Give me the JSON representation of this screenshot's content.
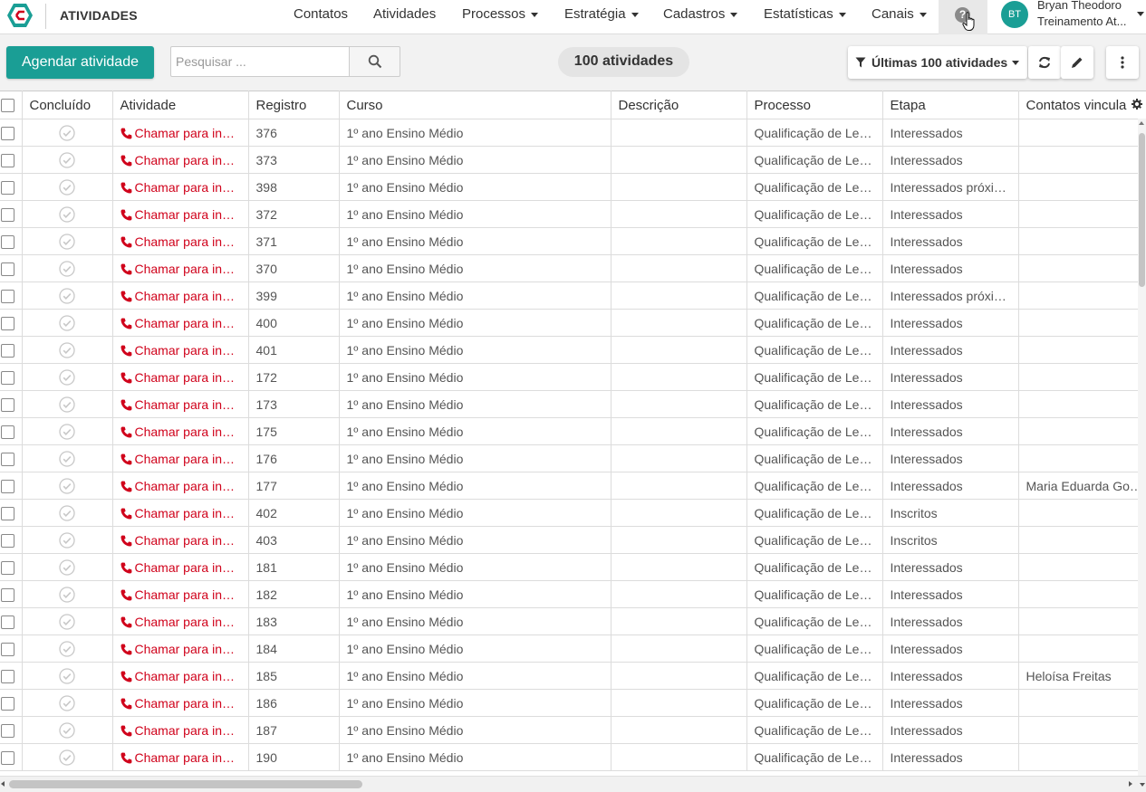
{
  "app": {
    "page_title": "ATIVIDADES",
    "brand_color": "#1a9e95",
    "accent_red": "#d0021b"
  },
  "nav": {
    "items": [
      {
        "label": "Contatos",
        "dropdown": false
      },
      {
        "label": "Atividades",
        "dropdown": false
      },
      {
        "label": "Processos",
        "dropdown": true
      },
      {
        "label": "Estratégia",
        "dropdown": true
      },
      {
        "label": "Cadastros",
        "dropdown": true
      },
      {
        "label": "Estatísticas",
        "dropdown": true
      },
      {
        "label": "Canais",
        "dropdown": true
      }
    ],
    "help_icon": "question-circle-icon"
  },
  "user": {
    "initials": "BT",
    "name": "Bryan Theodoro",
    "org": "Treinamento At..."
  },
  "toolbar": {
    "schedule_label": "Agendar atividade",
    "search_placeholder": "Pesquisar ...",
    "search_value": "",
    "count_label": "100 atividades",
    "filter_label": "Últimas 100 atividades",
    "refresh_icon": "refresh-icon",
    "edit_icon": "pencil-icon",
    "more_icon": "more-vertical-icon"
  },
  "table": {
    "columns": [
      "Concluído",
      "Atividade",
      "Registro",
      "Curso",
      "Descrição",
      "Processo",
      "Etapa",
      "Contatos vinculados"
    ],
    "rows": [
      {
        "atividade": "Chamar para inscrição",
        "registro": "376",
        "curso": "1º ano Ensino Médio",
        "descricao": "",
        "processo": "Qualificação de Leads",
        "etapa": "Interessados",
        "contatos": ""
      },
      {
        "atividade": "Chamar para inscrição",
        "registro": "373",
        "curso": "1º ano Ensino Médio",
        "descricao": "",
        "processo": "Qualificação de Leads",
        "etapa": "Interessados",
        "contatos": ""
      },
      {
        "atividade": "Chamar para inscrição",
        "registro": "398",
        "curso": "1º ano Ensino Médio",
        "descricao": "",
        "processo": "Qualificação de Leads",
        "etapa": "Interessados próximo ano",
        "contatos": ""
      },
      {
        "atividade": "Chamar para inscrição",
        "registro": "372",
        "curso": "1º ano Ensino Médio",
        "descricao": "",
        "processo": "Qualificação de Leads",
        "etapa": "Interessados",
        "contatos": ""
      },
      {
        "atividade": "Chamar para inscrição",
        "registro": "371",
        "curso": "1º ano Ensino Médio",
        "descricao": "",
        "processo": "Qualificação de Leads",
        "etapa": "Interessados",
        "contatos": ""
      },
      {
        "atividade": "Chamar para inscrição",
        "registro": "370",
        "curso": "1º ano Ensino Médio",
        "descricao": "",
        "processo": "Qualificação de Leads",
        "etapa": "Interessados",
        "contatos": ""
      },
      {
        "atividade": "Chamar para inscrição",
        "registro": "399",
        "curso": "1º ano Ensino Médio",
        "descricao": "",
        "processo": "Qualificação de Leads",
        "etapa": "Interessados próximo ano",
        "contatos": ""
      },
      {
        "atividade": "Chamar para inscrição",
        "registro": "400",
        "curso": "1º ano Ensino Médio",
        "descricao": "",
        "processo": "Qualificação de Leads",
        "etapa": "Interessados",
        "contatos": ""
      },
      {
        "atividade": "Chamar para inscrição",
        "registro": "401",
        "curso": "1º ano Ensino Médio",
        "descricao": "",
        "processo": "Qualificação de Leads",
        "etapa": "Interessados",
        "contatos": ""
      },
      {
        "atividade": "Chamar para inscrição",
        "registro": "172",
        "curso": "1º ano Ensino Médio",
        "descricao": "",
        "processo": "Qualificação de Leads",
        "etapa": "Interessados",
        "contatos": ""
      },
      {
        "atividade": "Chamar para inscrição",
        "registro": "173",
        "curso": "1º ano Ensino Médio",
        "descricao": "",
        "processo": "Qualificação de Leads",
        "etapa": "Interessados",
        "contatos": ""
      },
      {
        "atividade": "Chamar para inscrição",
        "registro": "175",
        "curso": "1º ano Ensino Médio",
        "descricao": "",
        "processo": "Qualificação de Leads",
        "etapa": "Interessados",
        "contatos": ""
      },
      {
        "atividade": "Chamar para inscrição",
        "registro": "176",
        "curso": "1º ano Ensino Médio",
        "descricao": "",
        "processo": "Qualificação de Leads",
        "etapa": "Interessados",
        "contatos": ""
      },
      {
        "atividade": "Chamar para inscrição",
        "registro": "177",
        "curso": "1º ano Ensino Médio",
        "descricao": "",
        "processo": "Qualificação de Leads",
        "etapa": "Interessados",
        "contatos": "Maria Eduarda Gonçalves"
      },
      {
        "atividade": "Chamar para inscrição",
        "registro": "402",
        "curso": "1º ano Ensino Médio",
        "descricao": "",
        "processo": "Qualificação de Leads",
        "etapa": "Inscritos",
        "contatos": ""
      },
      {
        "atividade": "Chamar para inscrição",
        "registro": "403",
        "curso": "1º ano Ensino Médio",
        "descricao": "",
        "processo": "Qualificação de Leads",
        "etapa": "Inscritos",
        "contatos": ""
      },
      {
        "atividade": "Chamar para inscrição",
        "registro": "181",
        "curso": "1º ano Ensino Médio",
        "descricao": "",
        "processo": "Qualificação de Leads",
        "etapa": "Interessados",
        "contatos": ""
      },
      {
        "atividade": "Chamar para inscrição",
        "registro": "182",
        "curso": "1º ano Ensino Médio",
        "descricao": "",
        "processo": "Qualificação de Leads",
        "etapa": "Interessados",
        "contatos": ""
      },
      {
        "atividade": "Chamar para inscrição",
        "registro": "183",
        "curso": "1º ano Ensino Médio",
        "descricao": "",
        "processo": "Qualificação de Leads",
        "etapa": "Interessados",
        "contatos": ""
      },
      {
        "atividade": "Chamar para inscrição",
        "registro": "184",
        "curso": "1º ano Ensino Médio",
        "descricao": "",
        "processo": "Qualificação de Leads",
        "etapa": "Interessados",
        "contatos": ""
      },
      {
        "atividade": "Chamar para inscrição",
        "registro": "185",
        "curso": "1º ano Ensino Médio",
        "descricao": "",
        "processo": "Qualificação de Leads",
        "etapa": "Interessados",
        "contatos": "Heloísa Freitas"
      },
      {
        "atividade": "Chamar para inscrição",
        "registro": "186",
        "curso": "1º ano Ensino Médio",
        "descricao": "",
        "processo": "Qualificação de Leads",
        "etapa": "Interessados",
        "contatos": ""
      },
      {
        "atividade": "Chamar para inscrição",
        "registro": "187",
        "curso": "1º ano Ensino Médio",
        "descricao": "",
        "processo": "Qualificação de Leads",
        "etapa": "Interessados",
        "contatos": ""
      },
      {
        "atividade": "Chamar para inscrição",
        "registro": "190",
        "curso": "1º ano Ensino Médio",
        "descricao": "",
        "processo": "Qualificação de Leads",
        "etapa": "Interessados",
        "contatos": ""
      }
    ]
  }
}
